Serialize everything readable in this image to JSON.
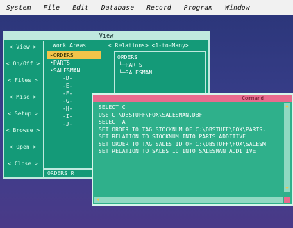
{
  "menubar": {
    "items": [
      {
        "label": "System"
      },
      {
        "label": "File"
      },
      {
        "label": "Edit"
      },
      {
        "label": "Database"
      },
      {
        "label": "Record"
      },
      {
        "label": "Program"
      },
      {
        "label": "Window"
      }
    ]
  },
  "view": {
    "title": "View",
    "side_buttons": [
      "< View >",
      "< On/Off >",
      "< Files >",
      "< Misc >",
      "< Setup >",
      "< Browse >",
      "< Open >",
      "< Close >"
    ],
    "work_areas_header": "Work Areas",
    "relations_header": "< Relations>  <1-to-Many>",
    "work_areas": [
      "▸ORDERS",
      "•PARTS",
      "•SALESMAN",
      "-D-",
      "-E-",
      "-F-",
      "-G-",
      "-H-",
      "-I-",
      "-J-"
    ],
    "tree": {
      "root": "ORDERS",
      "child1": "└─PARTS",
      "child2": "└─SALESMAN"
    },
    "bottom": "ORDERS      R"
  },
  "command": {
    "title": "Command",
    "lines": [
      "SELECT C",
      "USE C:\\DBSTUFF\\FOX\\SALESMAN.DBF",
      "SELECT A",
      "SET ORDER TO TAG STOCKNUM OF C:\\DBSTUFF\\FOX\\PARTS.",
      "SET RELATION TO STOCKNUM INTO PARTS ADDITIVE",
      "SET ORDER TO TAG SALES_ID OF C:\\DBSTUFF\\FOX\\SALESM",
      "SET RELATION TO SALES_ID INTO SALESMAN ADDITIVE"
    ]
  }
}
